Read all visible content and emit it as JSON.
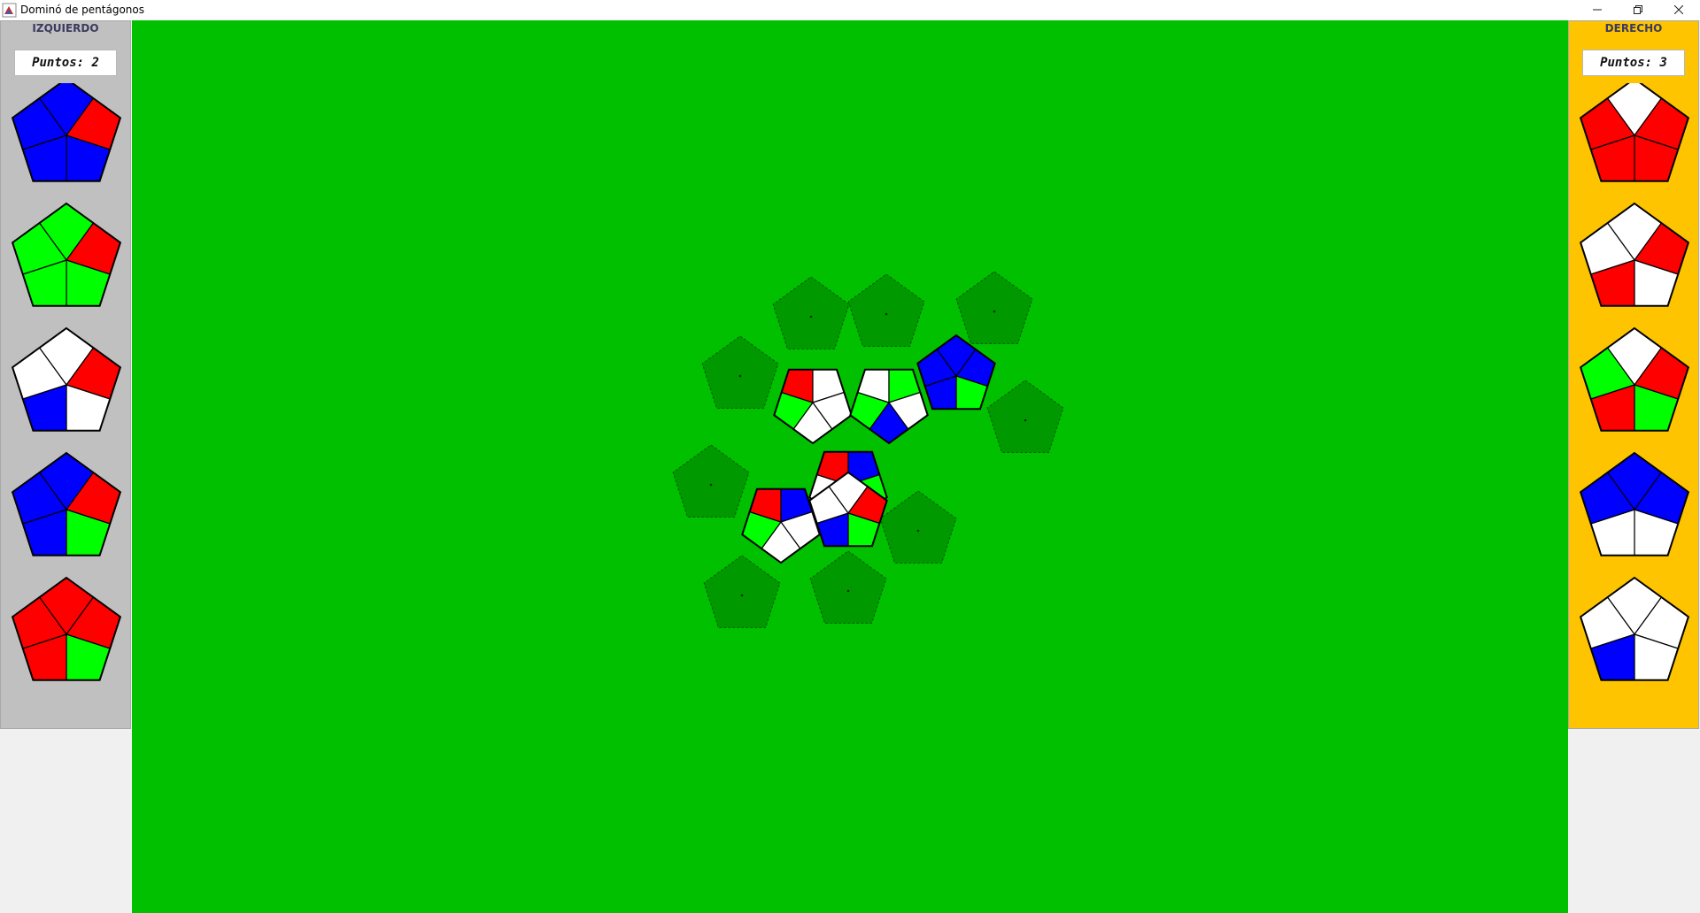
{
  "window": {
    "title": "Dominó de pentágonos",
    "buttons": {
      "minimize_icon": "minimize-icon",
      "restore_icon": "restore-icon",
      "close_icon": "close-icon"
    }
  },
  "colors": {
    "board": "#00c000",
    "left_panel": "#c0c0c0",
    "right_panel": "#fec400",
    "red": "#ff0000",
    "blue": "#0000ff",
    "green": "#00ff00",
    "white": "#ffffff",
    "slot": "#009a00"
  },
  "left_player": {
    "name": "IZQUIERDO",
    "score_label": "Puntos: 2",
    "tiles": [
      [
        "blue",
        "red",
        "blue",
        "blue",
        "blue"
      ],
      [
        "green",
        "red",
        "green",
        "green",
        "green"
      ],
      [
        "white",
        "red",
        "white",
        "blue",
        "white"
      ],
      [
        "blue",
        "red",
        "green",
        "blue",
        "blue"
      ],
      [
        "red",
        "red",
        "green",
        "red",
        "red"
      ]
    ]
  },
  "right_player": {
    "name": "DERECHO",
    "score_label": "Puntos: 3",
    "tiles": [
      [
        "white",
        "red",
        "red",
        "red",
        "red"
      ],
      [
        "white",
        "red",
        "white",
        "red",
        "white"
      ],
      [
        "white",
        "red",
        "green",
        "red",
        "green"
      ],
      [
        "blue",
        "blue",
        "white",
        "white",
        "blue"
      ],
      [
        "white",
        "white",
        "white",
        "blue",
        "white"
      ]
    ]
  }
}
